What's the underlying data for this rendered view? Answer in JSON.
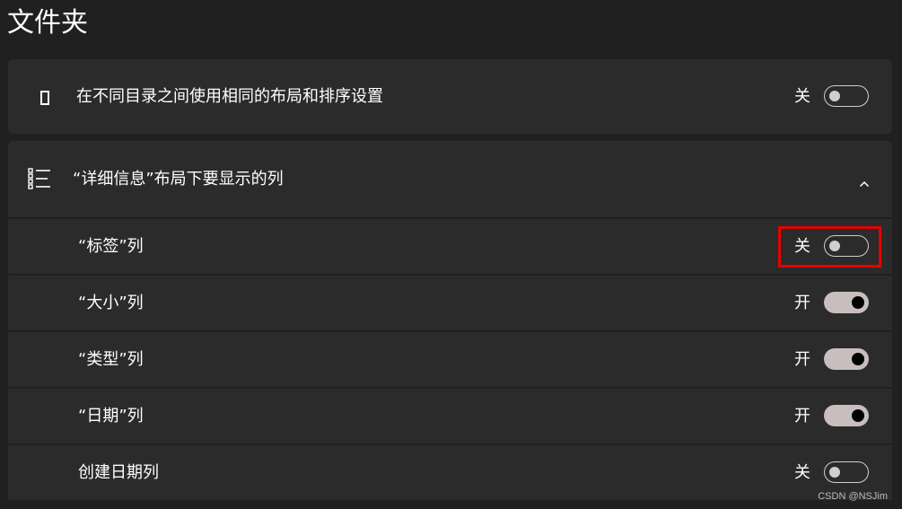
{
  "page": {
    "title": "文件夹"
  },
  "same_layout": {
    "label": "在不同目录之间使用相同的布局和排序设置",
    "state_label": "关",
    "toggle_on": false,
    "icon": "folder-rect-icon"
  },
  "details_columns": {
    "label": "“详细信息”布局下要显示的列",
    "icon": "details-list-icon",
    "expanded_icon": "chevron-up-icon",
    "rows": [
      {
        "label": "“标签”列",
        "state_label": "关",
        "toggle_on": false,
        "highlighted": true
      },
      {
        "label": "“大小”列",
        "state_label": "开",
        "toggle_on": true
      },
      {
        "label": "“类型”列",
        "state_label": "开",
        "toggle_on": true
      },
      {
        "label": "“日期”列",
        "state_label": "开",
        "toggle_on": true
      },
      {
        "label": "创建日期列",
        "state_label": "关",
        "toggle_on": false
      }
    ]
  },
  "watermark": "CSDN @NSJim",
  "colors": {
    "background": "#202020",
    "card": "#2b2b2b",
    "toggle_on_track": "#c8bebe",
    "highlight": "#e60000"
  }
}
